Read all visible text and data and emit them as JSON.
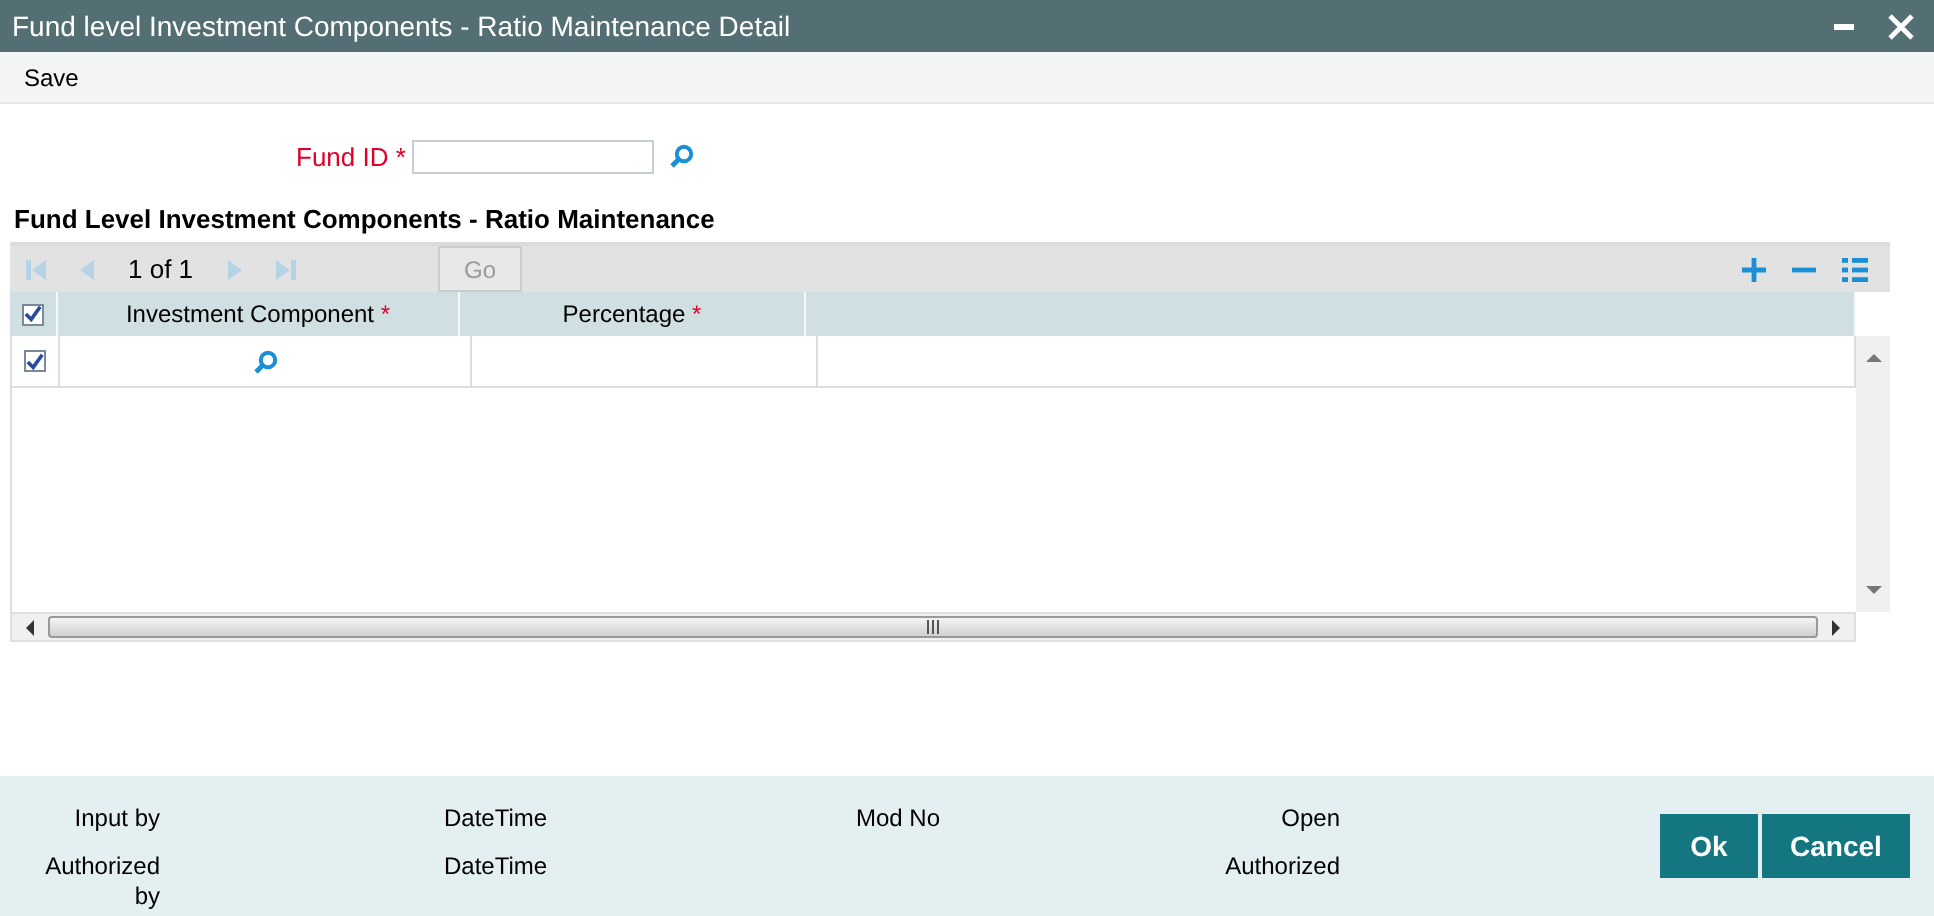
{
  "window": {
    "title": "Fund level Investment Components - Ratio Maintenance Detail"
  },
  "menu": [
    {
      "label": "Save"
    }
  ],
  "fund_id": {
    "label": "Fund ID",
    "mark": "*"
  },
  "section_title": "Fund Level Investment Components - Ratio Maintenance",
  "grid": {
    "pager": "1 of 1",
    "go": {
      "label": "Go",
      "disabled": true
    },
    "header_checked": true,
    "columns": [
      {
        "label": "Investment Component",
        "mark": "*"
      },
      {
        "label": "Percentage",
        "mark": "*"
      }
    ],
    "rows": [
      {
        "checked": true
      }
    ]
  },
  "audit": {
    "input_by": "Input by",
    "input_datetime": "DateTime",
    "mod_no": "Mod No",
    "record_status": "Open",
    "authorized_by": "Authorized by",
    "authorized_datetime": "DateTime",
    "auth_status": "Authorized"
  },
  "buttons": [
    {
      "label": "Ok"
    },
    {
      "label": "Cancel"
    }
  ]
}
